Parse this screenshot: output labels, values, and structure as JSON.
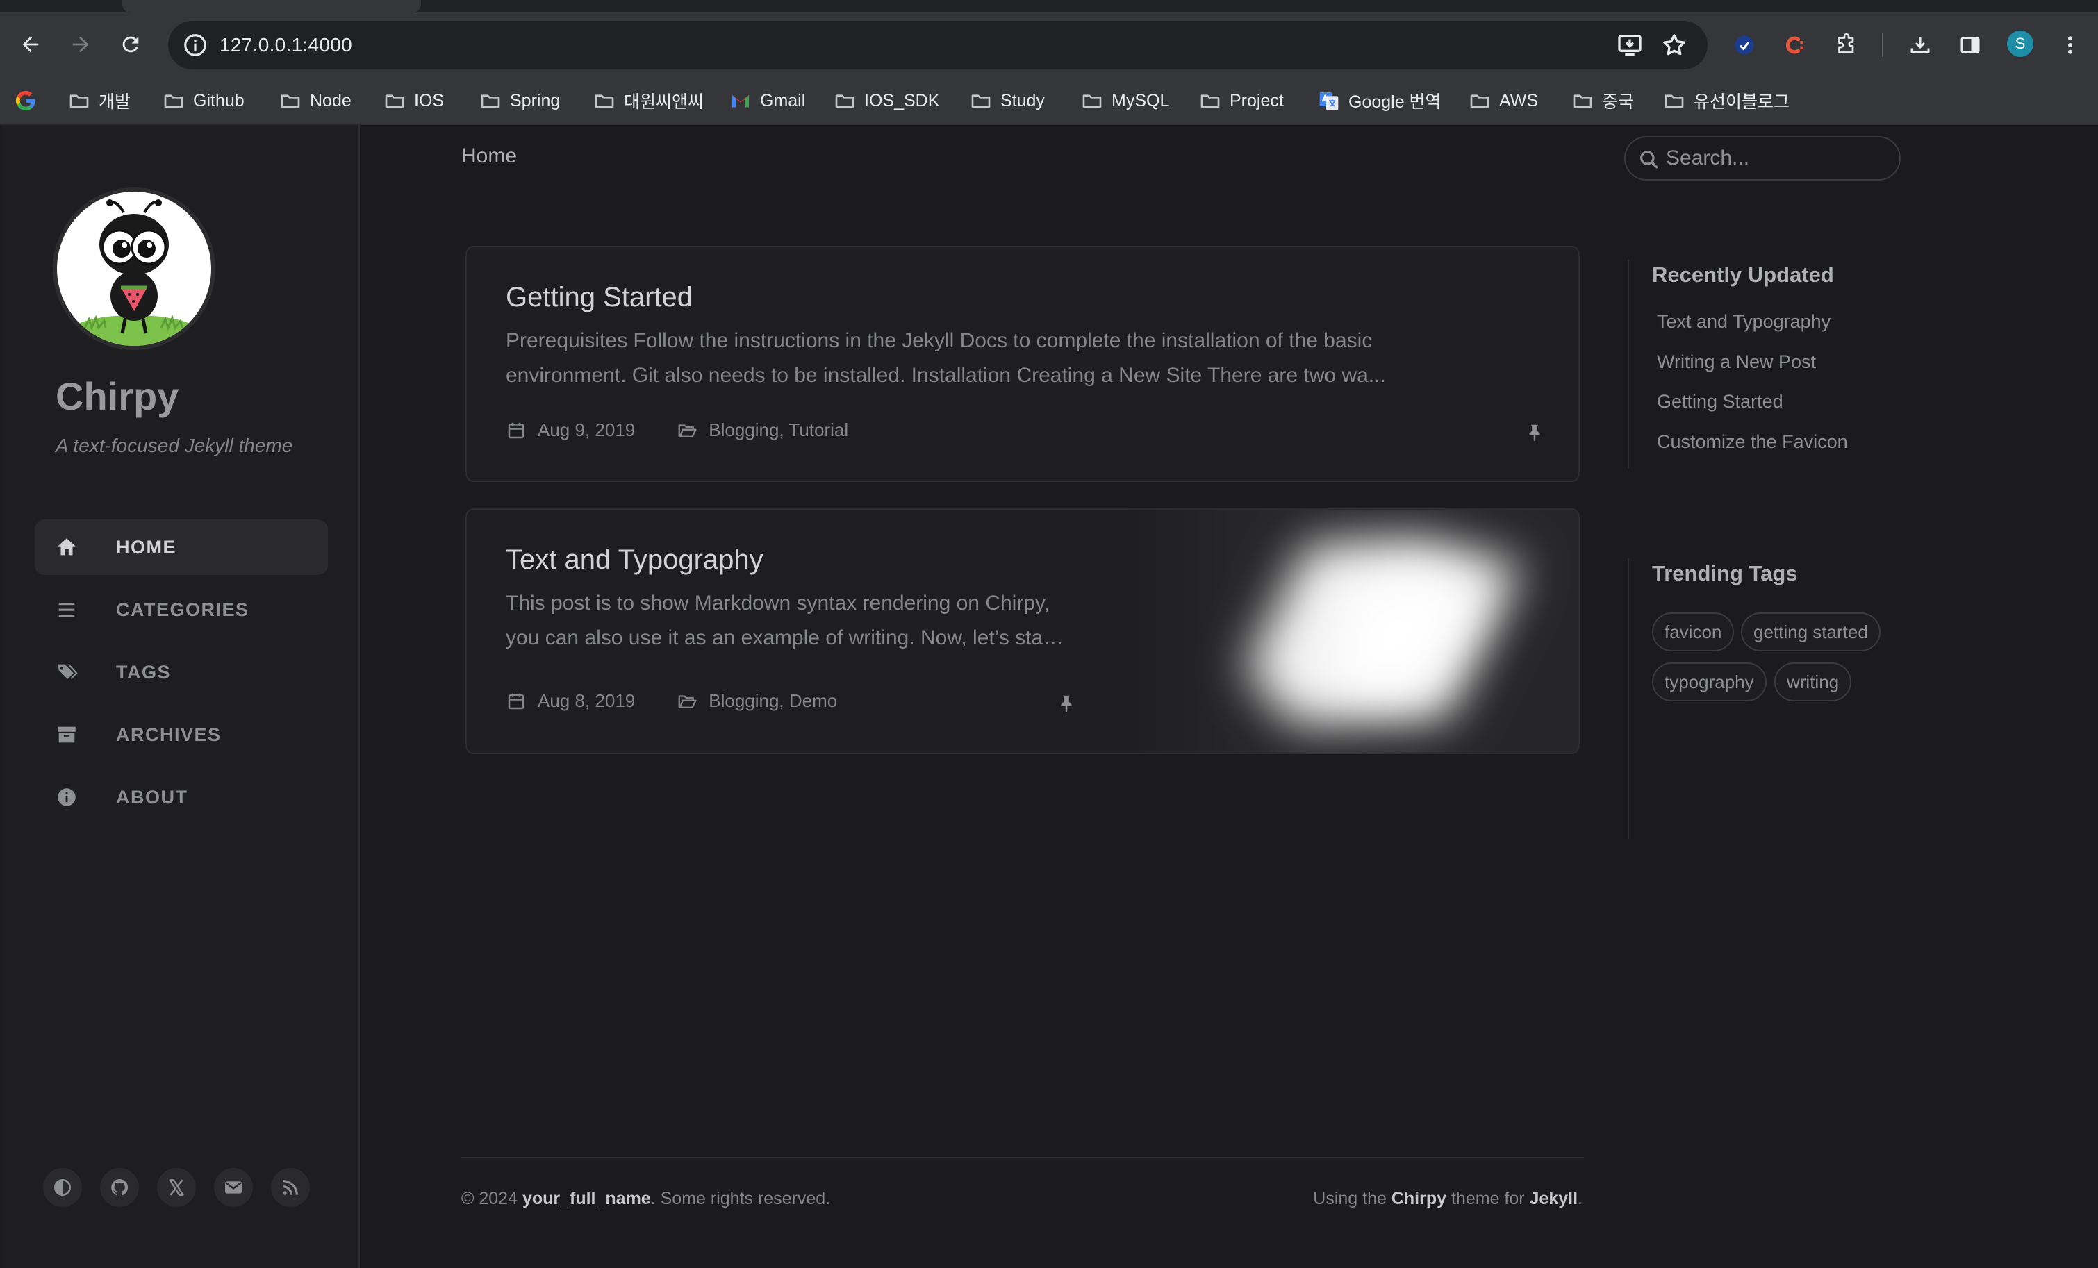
{
  "browser": {
    "url": "127.0.0.1:4000",
    "profile_initial": "S",
    "bookmarks": [
      {
        "label": "개발",
        "icon": "folder-icon"
      },
      {
        "label": "Github",
        "icon": "folder-icon"
      },
      {
        "label": "Node",
        "icon": "folder-icon"
      },
      {
        "label": "IOS",
        "icon": "folder-icon"
      },
      {
        "label": "Spring",
        "icon": "folder-icon"
      },
      {
        "label": "대원씨앤씨",
        "icon": "folder-icon"
      },
      {
        "label": "Gmail",
        "icon": "gmail-icon"
      },
      {
        "label": "IOS_SDK",
        "icon": "folder-icon"
      },
      {
        "label": "Study",
        "icon": "folder-icon"
      },
      {
        "label": "MySQL",
        "icon": "folder-icon"
      },
      {
        "label": "Project",
        "icon": "folder-icon"
      },
      {
        "label": "Google 번역",
        "icon": "google-translate-icon"
      },
      {
        "label": "AWS",
        "icon": "folder-icon"
      },
      {
        "label": "중국",
        "icon": "folder-icon"
      },
      {
        "label": "유선이블로그",
        "icon": "folder-icon"
      }
    ]
  },
  "sidebar": {
    "site_title": "Chirpy",
    "site_subtitle": "A text-focused Jekyll theme",
    "nav": [
      {
        "label": "HOME",
        "icon": "home-icon",
        "active": true
      },
      {
        "label": "CATEGORIES",
        "icon": "stream-icon",
        "active": false
      },
      {
        "label": "TAGS",
        "icon": "tags-icon",
        "active": false
      },
      {
        "label": "ARCHIVES",
        "icon": "archive-icon",
        "active": false
      },
      {
        "label": "ABOUT",
        "icon": "info-icon",
        "active": false
      }
    ],
    "bottom_icons": [
      "theme-toggle-icon",
      "github-icon",
      "x-icon",
      "email-icon",
      "rss-icon"
    ]
  },
  "topbar": {
    "breadcrumb": "Home",
    "search_placeholder": "Search..."
  },
  "posts": [
    {
      "title": "Getting Started",
      "excerpt_line1": "Prerequisites Follow the instructions in the Jekyll Docs to complete the installation of the basic",
      "excerpt_line2": "environment. Git also needs to be installed. Installation Creating a New Site There are two wa...",
      "date": "Aug 9, 2019",
      "categories": "Blogging, Tutorial",
      "pinned": true
    },
    {
      "title": "Text and Typography",
      "excerpt_line1": "This post is to show Markdown syntax rendering on Chirpy,",
      "excerpt_line2": "you can also use it as an example of writing. Now, let’s sta…",
      "date": "Aug 8, 2019",
      "categories": "Blogging, Demo",
      "pinned": true
    }
  ],
  "panel": {
    "recently_updated_heading": "Recently Updated",
    "recently_updated": [
      "Text and Typography",
      "Writing a New Post",
      "Getting Started",
      "Customize the Favicon"
    ],
    "trending_heading": "Trending Tags",
    "tags": [
      "favicon",
      "getting started",
      "typography",
      "writing"
    ]
  },
  "footer": {
    "copyright_prefix": "© 2024 ",
    "owner": "your_full_name",
    "copyright_suffix": ". Some rights reserved.",
    "using_prefix": "Using the ",
    "theme": "Chirpy",
    "theme_mid": " theme for ",
    "engine": "Jekyll",
    "end": "."
  },
  "colors": {
    "page_bg": "#1b1b1e",
    "sidebar_bg": "#1e1e20",
    "card_bg": "#1e1e20",
    "text_main": "#afb0b1",
    "heading": "#d3d3d5",
    "chrome_bg": "#35363a",
    "omnibox_bg": "#202124"
  }
}
